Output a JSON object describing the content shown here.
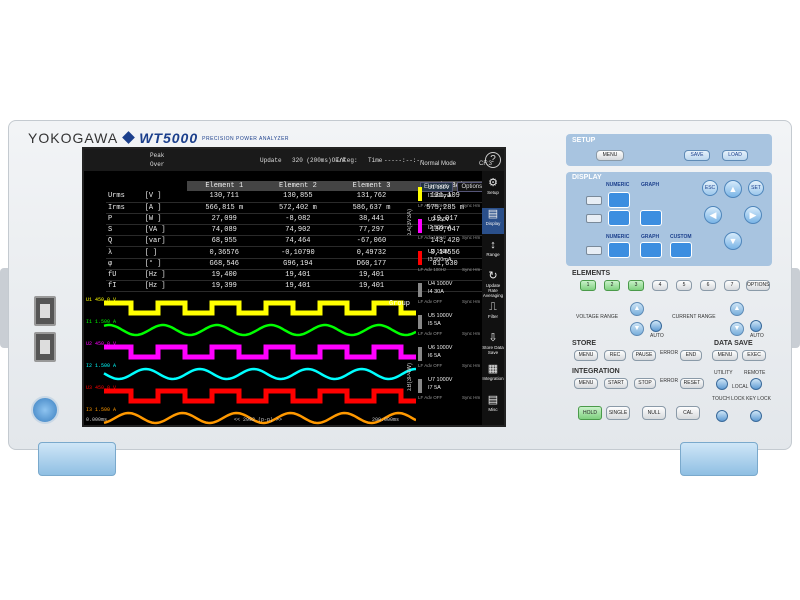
{
  "brand": {
    "name": "YOKOGAWA",
    "model": "WT5000",
    "subtitle": "PRECISION POWER ANALYZER"
  },
  "screen": {
    "topbar": {
      "peak_label": "Peak",
      "over_label": "Over",
      "update_label": "Update",
      "update_value": "320 (200ms)OF/F",
      "integ_label": "Integ:",
      "time_label": "Time",
      "time_value": "-----:--:--",
      "help_glyph": "?"
    },
    "mode": "Normal Mode",
    "cf": "CF:3",
    "page_indicator": "1",
    "table": {
      "headers": [
        "",
        "",
        "Element 1",
        "Element 2",
        "Element 3",
        "ΣA (3V3A)"
      ],
      "rows": [
        [
          "Urms",
          "[V ]",
          "130,711",
          "130,855",
          "131,762",
          "131,109"
        ],
        [
          "Irms",
          "[A ]",
          "566,815 m",
          "572,402 m",
          "586,637 m",
          "575,285 m"
        ],
        [
          "P",
          "[W ]",
          "27,099",
          "-8,082",
          "38,441",
          "19,017"
        ],
        [
          "S",
          "[VA ]",
          "74,089",
          "74,902",
          "77,297",
          "130,647"
        ],
        [
          "Q",
          "[var]",
          "68,955",
          "74,464",
          "-67,060",
          "143,420"
        ],
        [
          "λ",
          "[ ]",
          "0,36576",
          "-0,10790",
          "0,49732",
          "0,14556"
        ],
        [
          "φ",
          "[° ]",
          "G68,546",
          "G96,194",
          "D60,177",
          "81,630"
        ],
        [
          "fU",
          "[Hz ]",
          "19,400",
          "19,401",
          "19,401",
          ""
        ],
        [
          "fI",
          "[Hz ]",
          "19,399",
          "19,401",
          "19,401",
          ""
        ]
      ]
    },
    "wave": {
      "group_label": "Group",
      "time_left": "0.000ms",
      "time_center": "<< 2992 (p-p) >>",
      "time_right": "200.000ms",
      "traces": [
        {
          "label": "U1",
          "scale": "450.0 V",
          "color": "#ffff00",
          "shape": "square"
        },
        {
          "label": "I1",
          "scale": "1.500 A",
          "color": "#00ff00",
          "shape": "sine"
        },
        {
          "label": "U2",
          "scale": "450.0 V",
          "color": "#ff00ff",
          "shape": "square"
        },
        {
          "label": "I2",
          "scale": "1.500 A",
          "color": "#00ffff",
          "shape": "sine"
        },
        {
          "label": "U3",
          "scale": "450.0 V",
          "color": "#ff0000",
          "shape": "square"
        },
        {
          "label": "I3",
          "scale": "1.500 A",
          "color": "#ff9900",
          "shape": "sine"
        }
      ]
    },
    "elements_panel": {
      "tabs": [
        "Elements",
        "Options"
      ],
      "items": [
        {
          "u": "U1 150V",
          "i": "I1 500mA",
          "color": "#ffff00",
          "lf": "LF Adv 100Hz",
          "sync": "Sync Hm"
        },
        {
          "u": "U2 150V",
          "i": "I2 500mA",
          "color": "#ff00ff",
          "lf": "LF Adv 100Hz",
          "sync": "Sync Hm"
        },
        {
          "u": "U3 150V",
          "i": "I3 500mA",
          "color": "#ff0000",
          "lf": "LF Adv 100Hz",
          "sync": "Sync Hm"
        },
        {
          "u": "U4 1000V",
          "i": "I4 30A",
          "color": "#888888",
          "lf": "LF Adv OFF",
          "sync": "Sync Hm"
        },
        {
          "u": "U5 1000V",
          "i": "I5 5A",
          "color": "#888888",
          "lf": "LF Adv OFF",
          "sync": "Sync Hm"
        },
        {
          "u": "U6 1000V",
          "i": "I6 5A",
          "color": "#888888",
          "lf": "LF Adv OFF",
          "sync": "Sync Hm"
        },
        {
          "u": "U7 1000V",
          "i": "I7 5A",
          "color": "#888888",
          "lf": "LF Adv OFF",
          "sync": "Sync Hm"
        }
      ],
      "vertical_labels": [
        "ΣA(3V3A)",
        "ΣB(3P4W)"
      ]
    },
    "menu": [
      {
        "label": "Setup",
        "icon": "⚙"
      },
      {
        "label": "Display",
        "icon": "▤"
      },
      {
        "label": "Range",
        "icon": "↕"
      },
      {
        "label": "Update Rate Averaging",
        "icon": "↻"
      },
      {
        "label": "Filter",
        "icon": "⎍"
      },
      {
        "label": "Store Data Save",
        "icon": "⇩"
      },
      {
        "label": "Integration",
        "icon": "▦"
      },
      {
        "label": "Misc",
        "icon": "▤"
      }
    ]
  },
  "panel": {
    "setup": {
      "title": "SETUP",
      "menu": "MENU",
      "save": "SAVE",
      "load": "LOAD"
    },
    "display": {
      "title": "DISPLAY",
      "numeric": "NUMERIC",
      "graph": "GRAPH",
      "numeric2": "NUMERIC",
      "graph2": "GRAPH",
      "custom": "CUSTOM"
    },
    "nav": {
      "esc": "ESC",
      "set": "SET"
    },
    "elements": {
      "title": "ELEMENTS",
      "keys": [
        "1",
        "2",
        "3",
        "4",
        "5",
        "6",
        "7"
      ],
      "options": "OPTIONS"
    },
    "range": {
      "voltage": "VOLTAGE RANGE",
      "current": "CURRENT RANGE",
      "auto": "AUTO"
    },
    "store": {
      "title": "STORE",
      "menu": "MENU",
      "rec": "REC",
      "pause": "PAUSE",
      "error": "ERROR",
      "end": "END"
    },
    "data_save": {
      "title": "DATA SAVE",
      "menu": "MENU",
      "exec": "EXEC"
    },
    "integration": {
      "title": "INTEGRATION",
      "menu": "MENU",
      "start": "START",
      "stop": "STOP",
      "error": "ERROR",
      "reset": "RESET"
    },
    "utility": {
      "utility": "UTILITY",
      "remote": "REMOTE",
      "local": "LOCAL"
    },
    "bottom": {
      "hold": "HOLD",
      "single": "SINGLE",
      "null": "NULL",
      "cal": "CAL",
      "touch_lock": "TOUCH LOCK",
      "key_lock": "KEY LOCK"
    }
  },
  "colors": {
    "accent_blue": "#1b3f8c",
    "key_blue": "#3c8ee0",
    "panel_blue": "#a8c4e0",
    "element_green": "#7fd07f"
  }
}
